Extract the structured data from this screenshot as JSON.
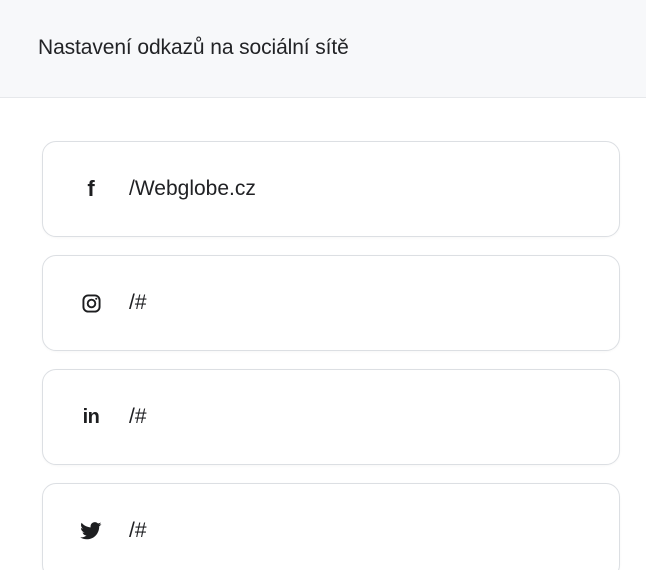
{
  "header": {
    "title": "Nastavení odkazů na sociální sítě"
  },
  "social_links": [
    {
      "network": "facebook",
      "icon": "facebook-icon",
      "value": "/Webglobe.cz"
    },
    {
      "network": "instagram",
      "icon": "instagram-icon",
      "value": "/#"
    },
    {
      "network": "linkedin",
      "icon": "linkedin-icon",
      "value": "/#"
    },
    {
      "network": "twitter",
      "icon": "twitter-icon",
      "value": "/#"
    }
  ],
  "colors": {
    "header_bg": "#f7f8fa",
    "card_border": "#dcdfe3",
    "text": "#202124"
  }
}
